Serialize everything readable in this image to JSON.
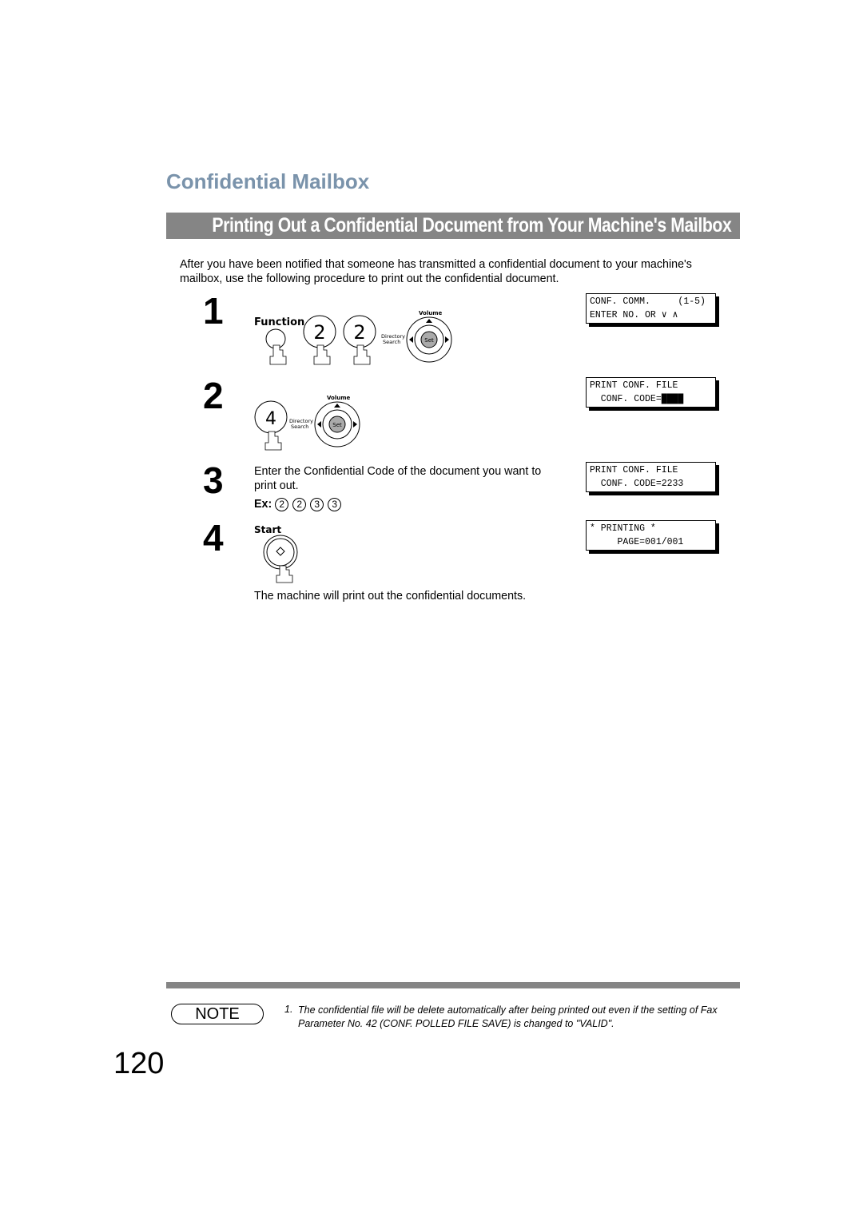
{
  "section_title": "Confidential Mailbox",
  "banner": "Printing Out a Confidential Document from Your Machine's Mailbox",
  "intro": "After you have been notified that someone has transmitted a confidential document to your machine's mailbox, use the following procedure to print out the confidential document.",
  "steps": [
    {
      "number": "1",
      "buttons": {
        "function": "Function",
        "key1": "2",
        "key2": "2",
        "volume": "Volume",
        "directory": "Directory",
        "search": "Search",
        "set": "Set"
      },
      "lcd": {
        "line1": "CONF. COMM.     (1-5)",
        "line2": "ENTER NO. OR ∨ ∧"
      }
    },
    {
      "number": "2",
      "buttons": {
        "key1": "4",
        "volume": "Volume",
        "directory": "Directory",
        "search": "Search",
        "set": "Set"
      },
      "lcd": {
        "line1": "PRINT CONF. FILE",
        "line2": "  CONF. CODE=████"
      }
    },
    {
      "number": "3",
      "text": "Enter the Confidential Code of the document you want to print out.",
      "example_label": "Ex:",
      "example_keys": [
        "2",
        "2",
        "3",
        "3"
      ],
      "lcd": {
        "line1": "PRINT CONF. FILE",
        "line2": "  CONF. CODE=2233"
      }
    },
    {
      "number": "4",
      "buttons": {
        "start": "Start"
      },
      "result": "The machine will print out the confidential documents.",
      "lcd": {
        "line1": "* PRINTING *",
        "line2": "     PAGE=001/001"
      }
    }
  ],
  "note": {
    "badge": "NOTE",
    "number": "1.",
    "text": "The confidential file will be delete automatically after being printed out even if the setting of Fax Parameter No. 42 (CONF. POLLED FILE SAVE) is changed to \"VALID\"."
  },
  "page_number": "120"
}
